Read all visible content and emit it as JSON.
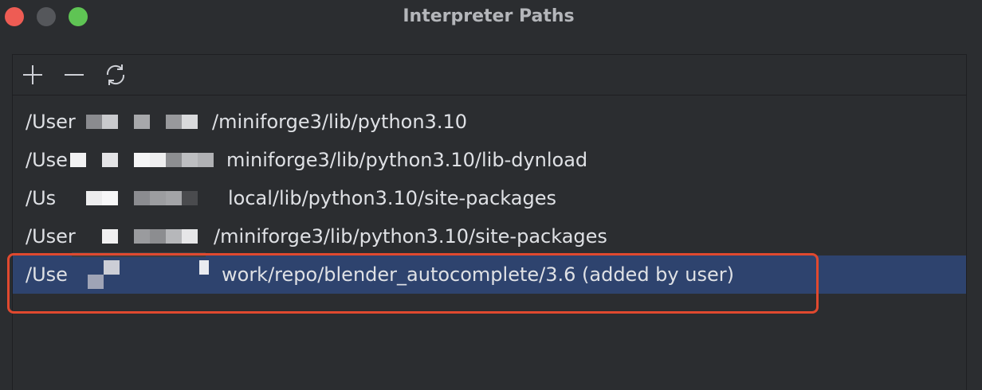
{
  "window": {
    "title": "Interpreter Paths",
    "traffic_lights": [
      "close",
      "minimize",
      "zoom"
    ]
  },
  "toolbar": {
    "add_icon": "plus-icon",
    "remove_icon": "minus-icon",
    "refresh_icon": "refresh-icon"
  },
  "paths": [
    {
      "prefix": "/User",
      "suffix": "/miniforge3/lib/python3.10",
      "selected": false
    },
    {
      "prefix": "/Use",
      "suffix": "miniforge3/lib/python3.10/lib-dynload",
      "selected": false
    },
    {
      "prefix": "/Us",
      "suffix": "local/lib/python3.10/site-packages",
      "selected": false
    },
    {
      "prefix": "/User",
      "suffix": "/miniforge3/lib/python3.10/site-packages",
      "selected": false
    },
    {
      "prefix": "/Use",
      "suffix": "work/repo/blender_autocomplete/3.6  (added by user)",
      "selected": true
    }
  ],
  "colors": {
    "background": "#2b2d30",
    "selection": "#2e436e",
    "highlight_border": "#e0492f",
    "text": "#dfe1e5"
  }
}
